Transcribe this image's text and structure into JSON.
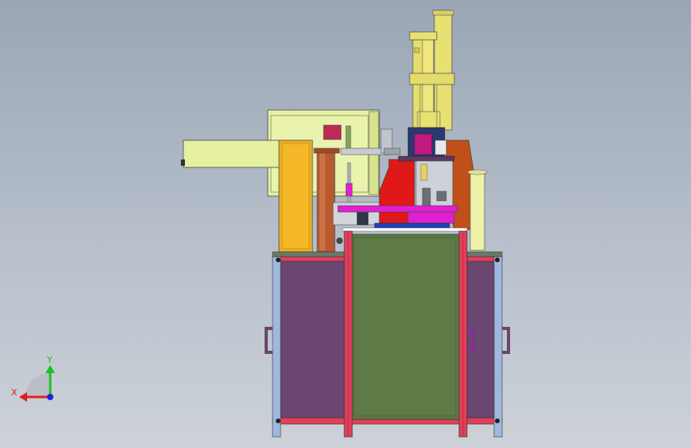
{
  "viewport": {
    "background_top": "#9aa6b6",
    "background_bottom": "#cdd2d8"
  },
  "triad": {
    "x_label": "X",
    "y_label": "Y",
    "x_color": "#e02020",
    "y_color": "#20c020",
    "z_color": "#2020e0"
  },
  "colors": {
    "cabinet_panel": "#6a4670",
    "cabinet_door": "#5e7a45",
    "frame_pink": "#e0405a",
    "frame_blue": "#a0b8e0",
    "yellow_cylinder": "#e8e070",
    "light_yellow_box": "#e6f0a0",
    "orange_column": "#f0b020",
    "copper_post": "#b85a30",
    "red_bracket": "#e01818",
    "rust_plate": "#c0501a",
    "magenta_plate": "#e020d0"
  }
}
